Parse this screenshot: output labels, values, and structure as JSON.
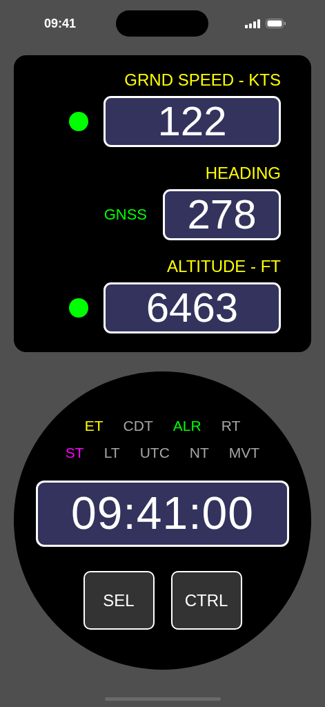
{
  "status_bar": {
    "time": "09:41"
  },
  "readouts": [
    {
      "label": "GRND SPEED - KTS",
      "value": "122",
      "indicator": {
        "kind": "dot",
        "color": "#00ff00"
      }
    },
    {
      "label": "HEADING",
      "value": "278",
      "indicator": {
        "kind": "source",
        "text": "GNSS"
      }
    },
    {
      "label": "ALTITUDE - FT",
      "value": "6463",
      "indicator": {
        "kind": "dot",
        "color": "#00ff00"
      }
    }
  ],
  "clock": {
    "modes": [
      [
        {
          "label": "ET",
          "color": "#ffff00"
        },
        {
          "label": "CDT",
          "color": "#a6a6a6"
        },
        {
          "label": "ALR",
          "color": "#00ff00"
        },
        {
          "label": "RT",
          "color": "#a6a6a6"
        }
      ],
      [
        {
          "label": "ST",
          "color": "#ff00ff"
        },
        {
          "label": "LT",
          "color": "#a6a6a6"
        },
        {
          "label": "UTC",
          "color": "#a6a6a6"
        },
        {
          "label": "NT",
          "color": "#a6a6a6"
        },
        {
          "label": "MVT",
          "color": "#a6a6a6"
        }
      ]
    ],
    "time": "09:41:00",
    "buttons": [
      "SEL",
      "CTRL"
    ]
  }
}
